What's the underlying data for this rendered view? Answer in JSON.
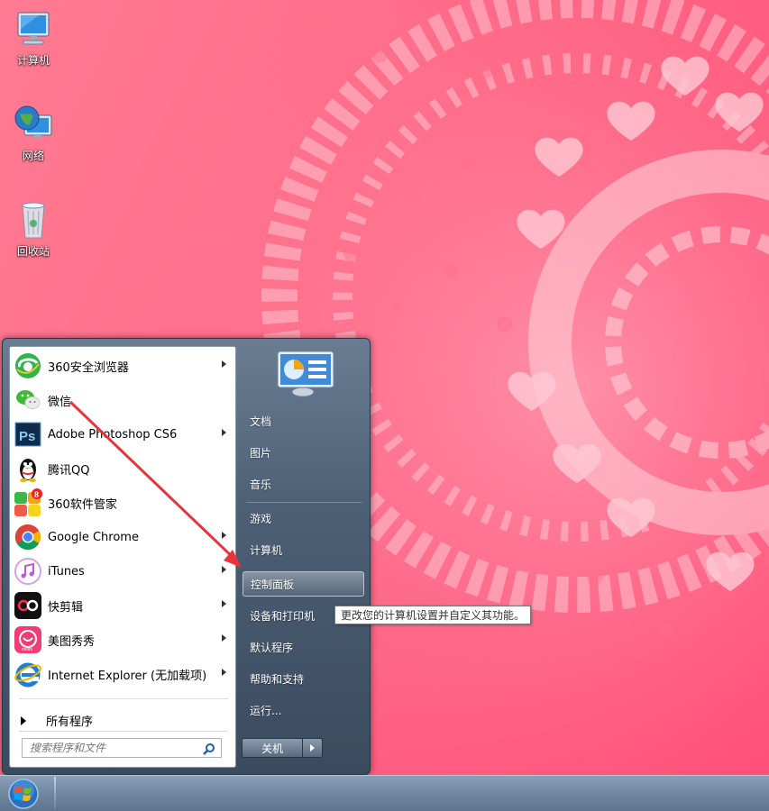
{
  "desktop": {
    "icons": [
      {
        "label": "计算机",
        "icon": "computer-icon"
      },
      {
        "label": "网络",
        "icon": "network-globe-icon"
      },
      {
        "label": "回收站",
        "icon": "recycle-bin-icon"
      }
    ]
  },
  "start_menu": {
    "programs": [
      {
        "label": "360安全浏览器",
        "icon": "360-browser-icon",
        "has_submenu": true
      },
      {
        "label": "微信",
        "icon": "wechat-icon",
        "has_submenu": false
      },
      {
        "label": "Adobe Photoshop CS6",
        "icon": "photoshop-icon",
        "has_submenu": true
      },
      {
        "label": "腾讯QQ",
        "icon": "qq-penguin-icon",
        "has_submenu": false
      },
      {
        "label": "360软件管家",
        "icon": "360-software-manager-icon",
        "has_submenu": false
      },
      {
        "label": "Google Chrome",
        "icon": "chrome-icon",
        "has_submenu": true
      },
      {
        "label": "iTunes",
        "icon": "itunes-icon",
        "has_submenu": true
      },
      {
        "label": "快剪辑",
        "icon": "kuaijianji-icon",
        "has_submenu": true
      },
      {
        "label": "美图秀秀",
        "icon": "meitu-icon",
        "has_submenu": true
      },
      {
        "label": "Internet Explorer (无加载项)",
        "icon": "internet-explorer-icon",
        "has_submenu": true
      }
    ],
    "all_programs": "所有程序",
    "search_placeholder": "搜索程序和文件",
    "right_items": [
      {
        "label": "文档"
      },
      {
        "label": "图片"
      },
      {
        "label": "音乐"
      },
      {
        "label": "游戏"
      },
      {
        "label": "计算机"
      },
      {
        "label": "控制面板",
        "highlighted": true
      },
      {
        "label": "设备和打印机"
      },
      {
        "label": "默认程序"
      },
      {
        "label": "帮助和支持"
      },
      {
        "label": "运行..."
      }
    ],
    "shutdown_label": "关机",
    "tooltip": "更改您的计算机设置并自定义其功能。"
  },
  "colors": {
    "wallpaper": "#ff6f8b",
    "annotation_arrow": "#e8343a",
    "menu_frame": "#4c5f75"
  }
}
